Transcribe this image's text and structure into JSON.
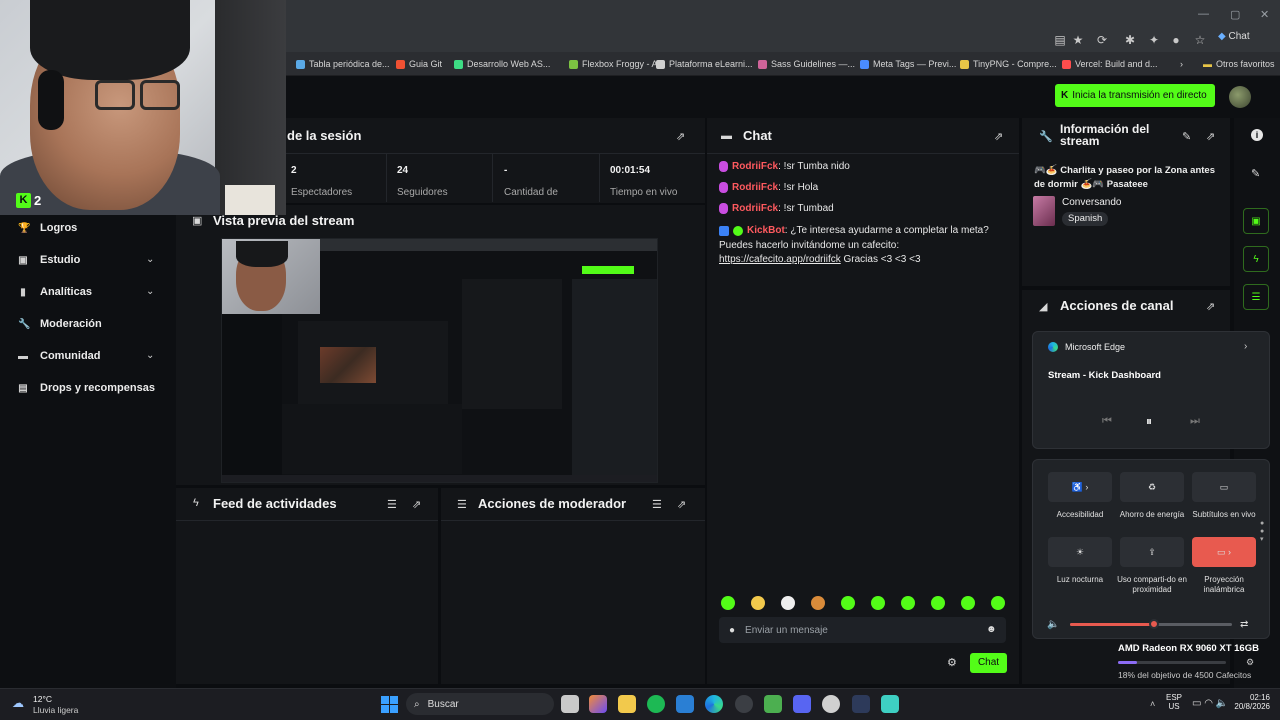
{
  "browser": {
    "profile_label": "Chat",
    "bookmarks": [
      {
        "label": "Tabla periódica de...",
        "color": "#5aa9e6"
      },
      {
        "label": "Guia Git",
        "color": "#f05133"
      },
      {
        "label": "Desarrollo Web AS...",
        "color": "#3ddc84"
      },
      {
        "label": "Flexbox Froggy - A...",
        "color": "#7cc242"
      },
      {
        "label": "Plataforma eLearni...",
        "color": "#d0d0d0"
      },
      {
        "label": "Sass Guidelines —...",
        "color": "#cf649a"
      },
      {
        "label": "Meta Tags — Previ...",
        "color": "#4a8cff"
      },
      {
        "label": "TinyPNG - Compre...",
        "color": "#e8c547"
      },
      {
        "label": "Vercel: Build and d...",
        "color": "#ff4d4d"
      }
    ],
    "bookmarks_more": "Otros favoritos"
  },
  "topbar": {
    "go_live_label": "Inicia la transmisión en directo"
  },
  "webcam": {
    "kick_count": "2"
  },
  "sidebar": {
    "items": [
      {
        "label": "Logros",
        "icon": "trophy-icon",
        "glyph": "🏆",
        "chevron": false
      },
      {
        "label": "Estudio",
        "icon": "studio-icon",
        "glyph": "▣",
        "chevron": true
      },
      {
        "label": "Analíticas",
        "icon": "analytics-icon",
        "glyph": "▮",
        "chevron": true
      },
      {
        "label": "Moderación",
        "icon": "wrench-icon",
        "glyph": "🔧",
        "chevron": false
      },
      {
        "label": "Comunidad",
        "icon": "chat-icon",
        "glyph": "▬",
        "chevron": true
      },
      {
        "label": "Drops y recompensas",
        "icon": "gift-icon",
        "glyph": "▤",
        "chevron": false
      }
    ]
  },
  "session": {
    "title": "de la sesión",
    "stats": [
      {
        "value": "2",
        "label": "Espectadores"
      },
      {
        "value": "24",
        "label": "Seguidores"
      },
      {
        "value": "-",
        "label": "Cantidad de"
      },
      {
        "value": "00:01:54",
        "label": "Tiempo en vivo"
      }
    ]
  },
  "preview": {
    "title": "Vista previa del stream"
  },
  "feed": {
    "title": "Feed de actividades"
  },
  "modactions": {
    "title": "Acciones de moderador"
  },
  "chat": {
    "title": "Chat",
    "messages": [
      {
        "user": "RodriiFck",
        "text": ": !sr Tumba nido"
      },
      {
        "user": "RodriiFck",
        "text": ": !sr Hola"
      },
      {
        "user": "RodriiFck",
        "text": ": !sr Tumbad"
      }
    ],
    "bot": {
      "user": "KickBot",
      "text1": ": ¿Te interesa ayudarme a completar la meta?",
      "text2": "Puedes hacerlo invitándome un cafecito:",
      "link": "https://cafecito.app/rodriifck",
      "text3": " Gracias <3 <3 <3"
    },
    "input_placeholder": "Enviar un mensaje",
    "send_label": "Chat"
  },
  "stream_info": {
    "title": "Información del stream",
    "stream_title_line1": "🎮🍝 Charlita y paseo por la Zona antes",
    "stream_title_line2": "de dormir 🍝🎮 Pasateee",
    "category": "Conversando",
    "language": "Spanish"
  },
  "channel_actions": {
    "title": "Acciones de canal"
  },
  "media": {
    "app": "Microsoft Edge",
    "title": "Stream - Kick Dashboard"
  },
  "quick_settings": {
    "tiles": [
      {
        "label": "Accesibilidad",
        "icon": "accessibility-icon",
        "glyph": "♿ ›",
        "active": false
      },
      {
        "label": "Ahorro de energía",
        "icon": "battery-saver-icon",
        "glyph": "♻",
        "active": false
      },
      {
        "label": "Subtítulos en vivo",
        "icon": "captions-icon",
        "glyph": "▭",
        "active": false
      },
      {
        "label": "Luz nocturna",
        "icon": "night-light-icon",
        "glyph": "☀",
        "active": false
      },
      {
        "label": "Uso comparti-do en proximidad",
        "icon": "nearby-share-icon",
        "glyph": "⇪",
        "active": false
      },
      {
        "label": "Proyección inalámbrica",
        "icon": "cast-icon",
        "glyph": "▭ ›",
        "active": true
      }
    ],
    "volume": 0.52,
    "gpu": "AMD Radeon RX 9060 XT 16GB",
    "goal": "18% del objetivo de 4500 Cafecitos",
    "goal_progress": 0.18
  },
  "taskbar": {
    "weather_temp": "12°C",
    "weather_desc": "Lluvia ligera",
    "search_label": "Buscar",
    "lang1": "ESP",
    "lang2": "US",
    "time": "02:16",
    "date": "20/8/2026"
  },
  "colors": {
    "kick_green": "#53fc18",
    "username_red": "#ff5a5f",
    "active_tile": "#e85a4f"
  }
}
